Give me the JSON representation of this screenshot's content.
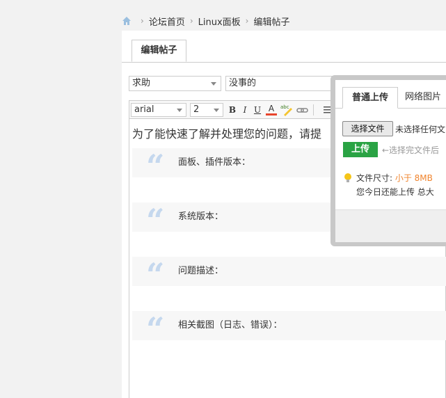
{
  "breadcrumb": {
    "items": [
      "论坛首页",
      "Linux面板",
      "编辑帖子"
    ],
    "separator": "›"
  },
  "tabs": {
    "edit": "编辑帖子"
  },
  "form": {
    "type_selected": "求助",
    "title_value": "没事的"
  },
  "toolbar": {
    "font": "arial",
    "size": "2",
    "bold": "B",
    "italic": "I",
    "underline": "U",
    "font_color": "A",
    "spell": "abc"
  },
  "editor": {
    "intro": "为了能快速了解并处理您的问题，请提",
    "quotes": [
      "面板、插件版本：",
      "系统版本：",
      "问题描述：",
      "相关截图（日志、错误）："
    ],
    "quote_mark": "“"
  },
  "upload": {
    "tab_normal": "普通上传",
    "tab_web": "网络图片",
    "choose_label": "选择文件",
    "no_file": "未选择任何文",
    "upload_label": "上传",
    "hint": "←选择完文件后",
    "size_label": "文件尺寸: ",
    "size_value": "小于 8MB",
    "remain": "您今日还能上传 总大"
  },
  "colors": {
    "accent_green": "#2aa344",
    "highlight_orange": "#f0842d",
    "quote_mark": "#c5d8ee"
  }
}
